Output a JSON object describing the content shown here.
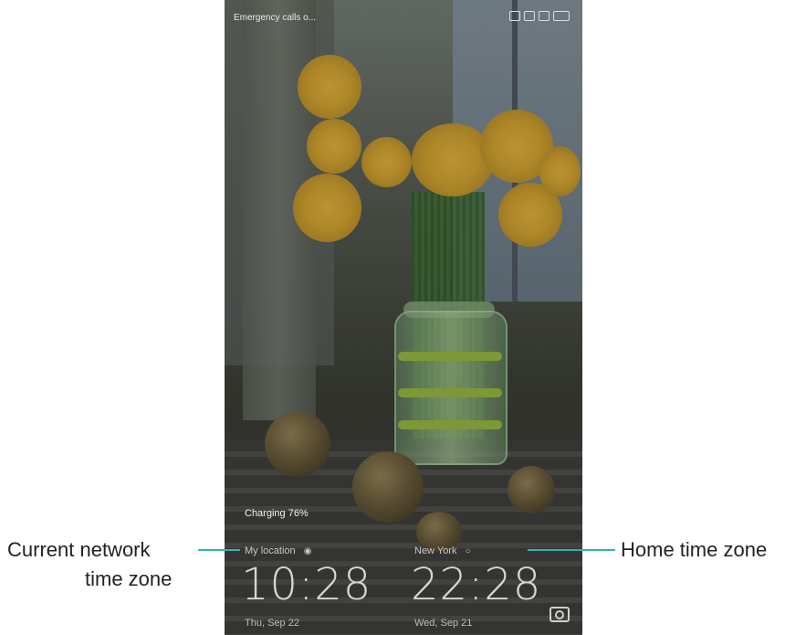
{
  "status_bar": {
    "left_text": "Emergency calls o..."
  },
  "lock_screen": {
    "charging_text": "Charging 76%",
    "clocks": [
      {
        "label": "My location",
        "time": "10:28",
        "date": "Thu, Sep 22"
      },
      {
        "label": "New York",
        "time": "22:28",
        "date": "Wed, Sep 21"
      }
    ]
  },
  "annotations": {
    "left_line1": "Current network",
    "left_line2": "time zone",
    "right": "Home time zone",
    "line_color": "#2fb6b6"
  },
  "icons": [
    "alarm-icon",
    "signal-icon",
    "sim-icon",
    "battery-icon",
    "location-icon",
    "globe-icon",
    "camera-icon"
  ]
}
